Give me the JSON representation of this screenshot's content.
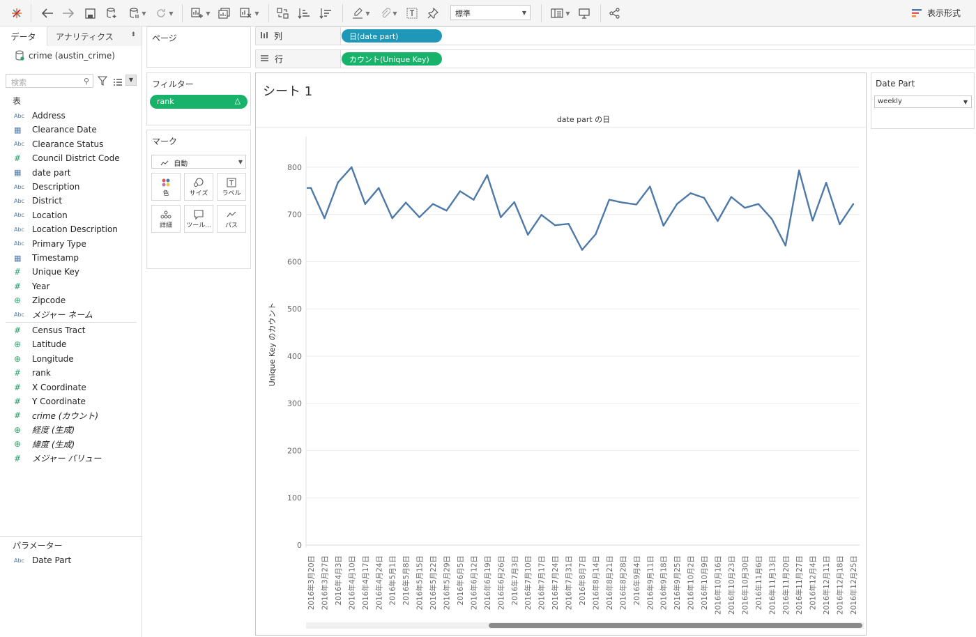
{
  "toolbar": {
    "fit_value": "標準",
    "show_me_label": "表示形式"
  },
  "data_pane": {
    "tabs": {
      "data": "データ",
      "analytics": "アナリティクス"
    },
    "datasource": "crime (austin_crime)",
    "search_placeholder": "検索",
    "tables_header": "表",
    "dimensions": [
      {
        "type": "Abc",
        "name": "Address"
      },
      {
        "type": "date",
        "name": "Clearance Date"
      },
      {
        "type": "Abc",
        "name": "Clearance Status"
      },
      {
        "type": "#",
        "name": "Council District Code"
      },
      {
        "type": "date",
        "name": "date part"
      },
      {
        "type": "Abc",
        "name": "Description"
      },
      {
        "type": "Abc",
        "name": "District"
      },
      {
        "type": "Abc",
        "name": "Location"
      },
      {
        "type": "Abc",
        "name": "Location Description"
      },
      {
        "type": "Abc",
        "name": "Primary Type"
      },
      {
        "type": "date",
        "name": "Timestamp"
      },
      {
        "type": "#",
        "name": "Unique Key"
      },
      {
        "type": "#",
        "name": "Year"
      },
      {
        "type": "geo",
        "name": "Zipcode"
      },
      {
        "type": "Abc",
        "name": "メジャー ネーム"
      }
    ],
    "measures": [
      {
        "type": "#",
        "name": "Census Tract"
      },
      {
        "type": "geo",
        "name": "Latitude"
      },
      {
        "type": "geo",
        "name": "Longitude"
      },
      {
        "type": "#",
        "name": "rank"
      },
      {
        "type": "#",
        "name": "X Coordinate"
      },
      {
        "type": "#",
        "name": "Y Coordinate"
      },
      {
        "type": "#",
        "name": "crime (カウント)"
      },
      {
        "type": "geo",
        "name": "経度 (生成)"
      },
      {
        "type": "geo",
        "name": "緯度 (生成)"
      },
      {
        "type": "#",
        "name": "メジャー バリュー"
      }
    ],
    "parameters_header": "パラメーター",
    "parameters": [
      {
        "type": "Abc",
        "name": "Date Part"
      }
    ]
  },
  "cards": {
    "pages": "ページ",
    "filters": "フィルター",
    "filter_pill": "rank",
    "marks": "マーク",
    "mark_type": "自動",
    "mark_buttons": [
      "色",
      "サイズ",
      "ラベル",
      "詳細",
      "ツール...",
      "パス"
    ]
  },
  "shelves": {
    "columns_label": "列",
    "columns_pill": "日(date part)",
    "rows_label": "行",
    "rows_pill": "カウント(Unique Key)"
  },
  "view": {
    "sheet_title": "シート 1",
    "header_title": "date part の日"
  },
  "parameter_control": {
    "title": "Date Part",
    "value": "weekly"
  },
  "chart_data": {
    "type": "line",
    "title": "date part の日",
    "xlabel": "",
    "ylabel": "Unique Key のカウント",
    "ylim": [
      0,
      850
    ],
    "yticks": [
      0,
      100,
      200,
      300,
      400,
      500,
      600,
      700,
      800
    ],
    "grid": true,
    "line_color": "#4e79a7",
    "categories": [
      "2016年3月20日",
      "2016年3月27日",
      "2016年4月3日",
      "2016年4月10日",
      "2016年4月17日",
      "2016年4月24日",
      "2016年5月1日",
      "2016年5月8日",
      "2016年5月15日",
      "2016年5月22日",
      "2016年5月29日",
      "2016年6月5日",
      "2016年6月12日",
      "2016年6月19日",
      "2016年6月26日",
      "2016年7月3日",
      "2016年7月10日",
      "2016年7月17日",
      "2016年7月24日",
      "2016年7月31日",
      "2016年8月7日",
      "2016年8月14日",
      "2016年8月21日",
      "2016年8月28日",
      "2016年9月4日",
      "2016年9月11日",
      "2016年9月18日",
      "2016年9月25日",
      "2016年10月2日",
      "2016年10月9日",
      "2016年10月16日",
      "2016年10月23日",
      "2016年10月30日",
      "2016年11月6日",
      "2016年11月13日",
      "2016年11月20日",
      "2016年11月27日",
      "2016年12月4日",
      "2016年12月11日",
      "2016年12月18日",
      "2016年12月25日"
    ],
    "series": [
      {
        "values": [
          756,
          692,
          768,
          800,
          722,
          756,
          692,
          725,
          694,
          722,
          708,
          749,
          731,
          783,
          694,
          726,
          657,
          699,
          677,
          680,
          625,
          658,
          731,
          725,
          721,
          759,
          676,
          722,
          745,
          735,
          686,
          737,
          714,
          722,
          690,
          634,
          793,
          687,
          767,
          679,
          722
        ]
      }
    ]
  }
}
